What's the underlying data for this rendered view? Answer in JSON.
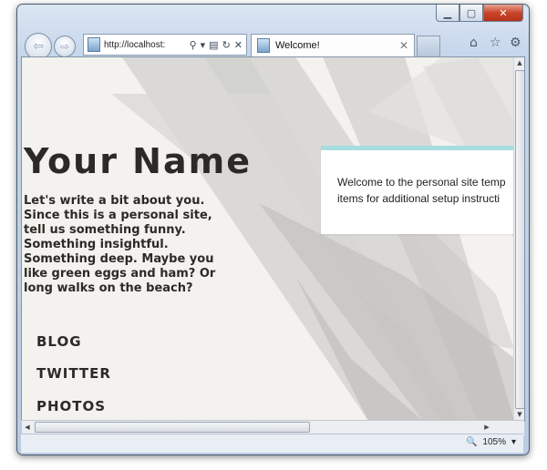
{
  "window": {
    "minimize_icon": "minimize-icon",
    "maximize_icon": "maximize-icon",
    "close_icon": "close-icon"
  },
  "navbar": {
    "address": "http://localhost:",
    "tab_title": "Welcome!",
    "icons": [
      "back-arrow-icon",
      "forward-arrow-icon",
      "search-icon",
      "dropdown-icon",
      "compatibility-icon",
      "refresh-icon",
      "stop-icon",
      "home-icon",
      "favorites-star-icon",
      "tools-gear-icon"
    ]
  },
  "page": {
    "name": "Your Name",
    "bio": "Let's write a bit about you. Since this is a personal site, tell us something funny. Something insightful. Something deep. Maybe you like green eggs and ham? Or long walks on the beach?",
    "links": [
      "BLOG",
      "TWITTER",
      "PHOTOS"
    ],
    "card_text_line1": "Welcome to the personal site temp",
    "card_text_line2": "items for additional setup instructi",
    "card_accent": "#a6dde0",
    "background": "#f4f2ee"
  },
  "statusbar": {
    "zoom": "105%"
  }
}
